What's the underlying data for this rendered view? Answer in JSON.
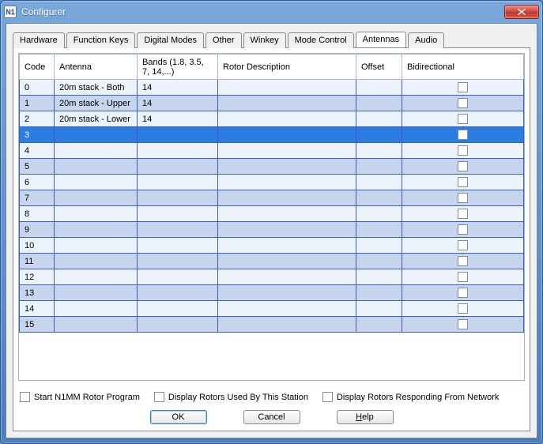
{
  "window": {
    "title": "Configurer",
    "icon_label": "N1"
  },
  "tabs": [
    {
      "label": "Hardware"
    },
    {
      "label": "Function Keys"
    },
    {
      "label": "Digital Modes"
    },
    {
      "label": "Other"
    },
    {
      "label": "Winkey"
    },
    {
      "label": "Mode Control"
    },
    {
      "label": "Antennas",
      "active": true
    },
    {
      "label": "Audio"
    }
  ],
  "columns": {
    "code": "Code",
    "antenna": "Antenna",
    "bands": "Bands (1.8, 3.5, 7, 14,...)",
    "rotor": "Rotor Description",
    "offset": "Offset",
    "bidir": "Bidirectional"
  },
  "rows": [
    {
      "code": "0",
      "antenna": "20m stack - Both",
      "bands": "14",
      "rotor": "",
      "offset": "",
      "bidir": false,
      "selected": false
    },
    {
      "code": "1",
      "antenna": "20m stack - Upper",
      "bands": "14",
      "rotor": "",
      "offset": "",
      "bidir": false,
      "selected": false
    },
    {
      "code": "2",
      "antenna": "20m stack - Lower",
      "bands": "14",
      "rotor": "",
      "offset": "",
      "bidir": false,
      "selected": false
    },
    {
      "code": "3",
      "antenna": "",
      "bands": "",
      "rotor": "",
      "offset": "",
      "bidir": false,
      "selected": true
    },
    {
      "code": "4",
      "antenna": "",
      "bands": "",
      "rotor": "",
      "offset": "",
      "bidir": false,
      "selected": false
    },
    {
      "code": "5",
      "antenna": "",
      "bands": "",
      "rotor": "",
      "offset": "",
      "bidir": false,
      "selected": false
    },
    {
      "code": "6",
      "antenna": "",
      "bands": "",
      "rotor": "",
      "offset": "",
      "bidir": false,
      "selected": false
    },
    {
      "code": "7",
      "antenna": "",
      "bands": "",
      "rotor": "",
      "offset": "",
      "bidir": false,
      "selected": false
    },
    {
      "code": "8",
      "antenna": "",
      "bands": "",
      "rotor": "",
      "offset": "",
      "bidir": false,
      "selected": false
    },
    {
      "code": "9",
      "antenna": "",
      "bands": "",
      "rotor": "",
      "offset": "",
      "bidir": false,
      "selected": false
    },
    {
      "code": "10",
      "antenna": "",
      "bands": "",
      "rotor": "",
      "offset": "",
      "bidir": false,
      "selected": false
    },
    {
      "code": "11",
      "antenna": "",
      "bands": "",
      "rotor": "",
      "offset": "",
      "bidir": false,
      "selected": false
    },
    {
      "code": "12",
      "antenna": "",
      "bands": "",
      "rotor": "",
      "offset": "",
      "bidir": false,
      "selected": false
    },
    {
      "code": "13",
      "antenna": "",
      "bands": "",
      "rotor": "",
      "offset": "",
      "bidir": false,
      "selected": false
    },
    {
      "code": "14",
      "antenna": "",
      "bands": "",
      "rotor": "",
      "offset": "",
      "bidir": false,
      "selected": false
    },
    {
      "code": "15",
      "antenna": "",
      "bands": "",
      "rotor": "",
      "offset": "",
      "bidir": false,
      "selected": false
    }
  ],
  "options": {
    "start_rotor": "Start N1MM Rotor Program",
    "display_used": "Display Rotors Used By This Station",
    "display_network": "Display Rotors Responding From Network"
  },
  "buttons": {
    "ok": "OK",
    "cancel": "Cancel",
    "help": "Help"
  }
}
